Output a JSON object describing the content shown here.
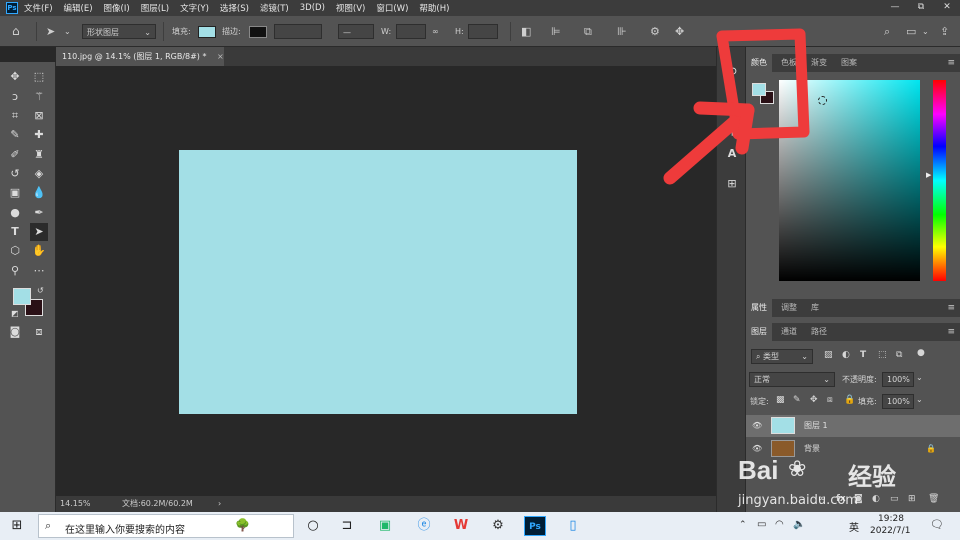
{
  "menubar": {
    "logo": "Ps",
    "items": [
      "文件(F)",
      "编辑(E)",
      "图像(I)",
      "图层(L)",
      "文字(Y)",
      "选择(S)",
      "滤镜(T)",
      "3D(D)",
      "视图(V)",
      "窗口(W)",
      "帮助(H)"
    ],
    "controls": [
      "—",
      "⧉",
      "✕"
    ]
  },
  "options": {
    "mode_value": "形状图层",
    "fill_label": "填充:",
    "fill_color": "#a3dfe6",
    "stroke_label": "描边:",
    "w_label": "W:",
    "h_label": "H:"
  },
  "document": {
    "tab_title": "110.jpg @ 14.1% (图层 1, RGB/8#) *",
    "tab_close": "×",
    "canvas_color": "#a3dfe6",
    "status_zoom": "14.15%",
    "status_doc": "文档:60.2M/60.2M"
  },
  "toolbar": {
    "foreground_color": "#a3dfe6",
    "background_color": "#2a1016"
  },
  "color_panel": {
    "tabs": [
      "颜色",
      "色板",
      "渐变",
      "图案"
    ],
    "active_tab": "颜色",
    "menu": "≡"
  },
  "properties_panel": {
    "tabs": [
      "属性",
      "调整",
      "库"
    ],
    "active_tab": "属性",
    "menu": "≡"
  },
  "layers_panel": {
    "tabs": [
      "图层",
      "通道",
      "路径"
    ],
    "active_tab": "图层",
    "menu": "≡",
    "filter_value": "类型",
    "blend_mode": "正常",
    "opacity_label": "不透明度:",
    "opacity_value": "100%",
    "lock_label": "锁定:",
    "fill_label": "填充:",
    "fill_value": "100%",
    "layers": [
      {
        "name": "图层 1",
        "thumb_color": "#a3dfe6",
        "selected": true
      },
      {
        "name": "背景",
        "thumb_color": "#8a5a2a",
        "selected": false
      }
    ]
  },
  "taskbar": {
    "search_placeholder": "在这里输入你要搜索的内容",
    "lang": "英",
    "time": "19:28",
    "date": "2022/7/1"
  },
  "watermark": {
    "brand": "Bai",
    "brand2": "经验",
    "url": "jingyan.baidu.com"
  },
  "annotation": {
    "color": "#ee3b3b"
  }
}
